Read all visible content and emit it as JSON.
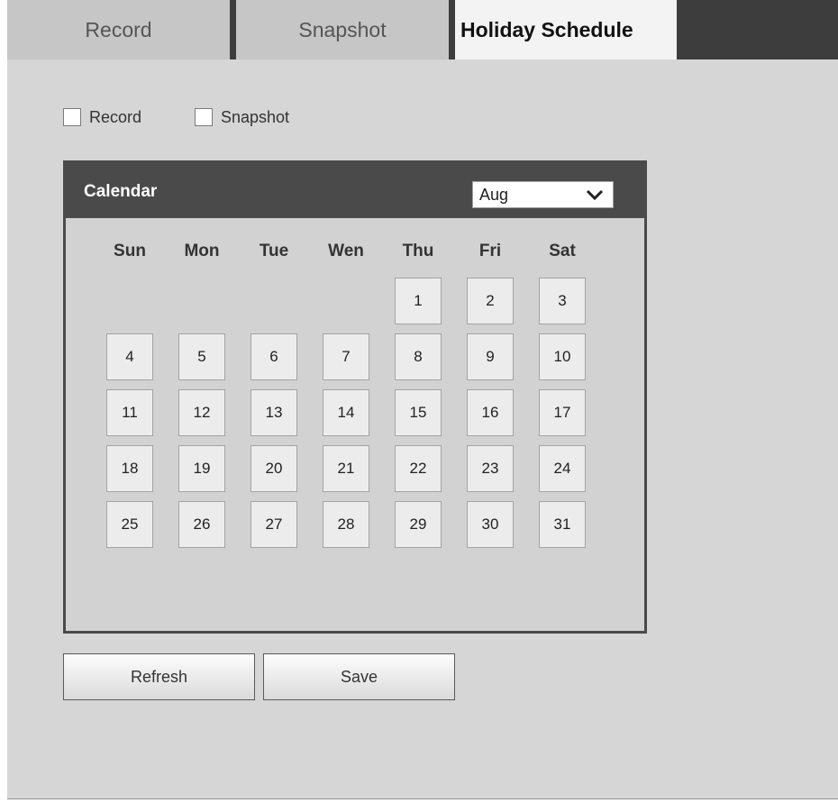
{
  "tabs": {
    "record": "Record",
    "snapshot": "Snapshot",
    "holiday_schedule": "Holiday Schedule"
  },
  "options": {
    "record_label": "Record",
    "record_checked": false,
    "snapshot_label": "Snapshot",
    "snapshot_checked": false
  },
  "calendar": {
    "title": "Calendar",
    "month": "Aug",
    "weekdays": [
      "Sun",
      "Mon",
      "Tue",
      "Wen",
      "Thu",
      "Fri",
      "Sat"
    ],
    "days": [
      "1",
      "2",
      "3",
      "4",
      "5",
      "6",
      "7",
      "8",
      "9",
      "10",
      "11",
      "12",
      "13",
      "14",
      "15",
      "16",
      "17",
      "18",
      "19",
      "20",
      "21",
      "22",
      "23",
      "24",
      "25",
      "26",
      "27",
      "28",
      "29",
      "30",
      "31"
    ]
  },
  "buttons": {
    "refresh": "Refresh",
    "save": "Save"
  }
}
